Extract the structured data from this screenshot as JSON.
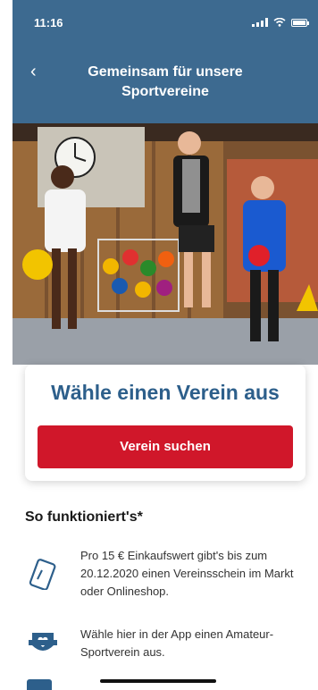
{
  "status_bar": {
    "time": "11:16"
  },
  "nav": {
    "title_line1": "Gemeinsam für unsere",
    "title_line2": "Sportvereine",
    "back_glyph": "‹"
  },
  "card": {
    "headline": "Wähle einen Verein aus",
    "button_label": "Verein suchen"
  },
  "how": {
    "title": "So funktioniert's*",
    "steps": [
      {
        "icon": "ticket-icon",
        "text": "Pro 15 € Einkaufswert gibt's bis zum 20.12.2020 einen Vereinsschein im Markt oder Onlineshop."
      },
      {
        "icon": "heart-shield-icon",
        "text": "Wähle hier in der App einen Amateur-Sportverein aus."
      }
    ]
  },
  "colors": {
    "primary": "#3d6a90",
    "accent": "#d0172a",
    "headline": "#2d5f8b"
  }
}
